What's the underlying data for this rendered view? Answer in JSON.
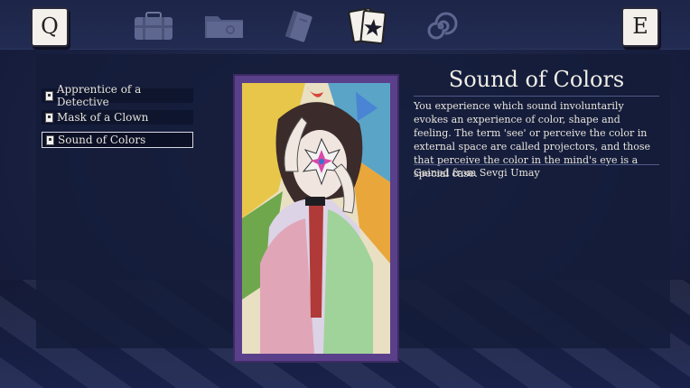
{
  "topbar": {
    "left_key": "Q",
    "right_key": "E",
    "icons": [
      "briefcase-icon",
      "folder-icon",
      "notebook-icon",
      "cards-icon",
      "spiral-icon"
    ]
  },
  "abilities": {
    "items": [
      {
        "label": "Apprentice of a Detective"
      },
      {
        "label": "Mask of a Clown"
      },
      {
        "label": "Sound of Colors"
      }
    ],
    "selected_index": 2
  },
  "detail": {
    "title": "Sound of Colors",
    "description": "You experience which sound involuntarily evokes an experience of color, shape and feeling. The term 'see' or perceive the color in external space are called projectors, and those that perceive the color in the mind's eye is a  special case.",
    "source": "Gained from Sevgi Umay"
  },
  "colors": {
    "background": "#1a2142",
    "card_border": "#5a3f8a",
    "text": "#e8e4dc"
  }
}
